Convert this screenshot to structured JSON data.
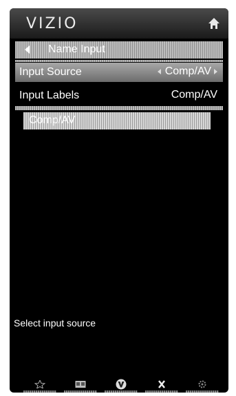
{
  "header": {
    "brand": "VIZIO",
    "home_icon": "home-icon"
  },
  "breadcrumb": {
    "title": "Name Input",
    "back_icon": "back-arrow-icon"
  },
  "menu": {
    "input_source": {
      "label": "Input Source",
      "value": "Comp/AV"
    },
    "input_labels": {
      "label": "Input Labels",
      "value": "Comp/AV"
    }
  },
  "entry": {
    "value": "Comp/AV"
  },
  "help_text": "Select input source",
  "footer": {
    "icons": [
      "star-icon",
      "closed-caption-icon",
      "vizio-v-icon",
      "close-x-icon",
      "gear-icon"
    ]
  }
}
